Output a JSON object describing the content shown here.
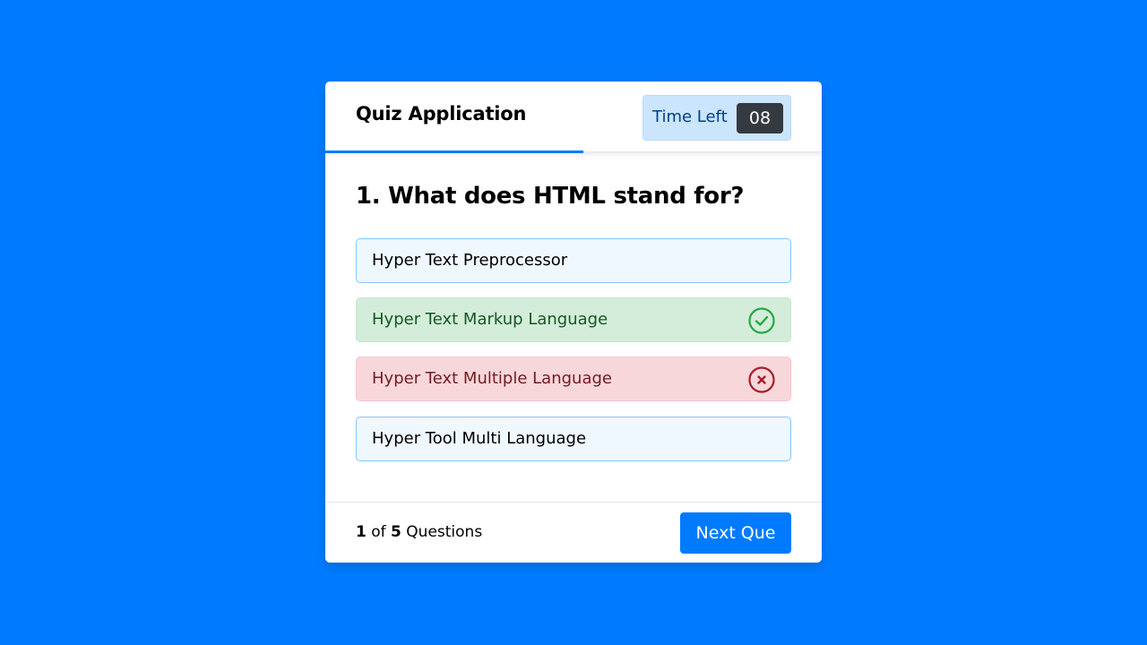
{
  "header": {
    "title": "Quiz Application",
    "timer_label": "Time Left",
    "timer_value": "08"
  },
  "question": {
    "text": "1. What does HTML stand for?"
  },
  "options": [
    {
      "label": "Hyper Text Preprocessor",
      "state": "default"
    },
    {
      "label": "Hyper Text Markup Language",
      "state": "correct",
      "icon": "check-circle-icon"
    },
    {
      "label": "Hyper Text Multiple Language",
      "state": "incorrect",
      "icon": "cross-circle-icon"
    },
    {
      "label": "Hyper Tool Multi Language",
      "state": "default"
    }
  ],
  "footer": {
    "current": "1",
    "of_text": "of",
    "total": "5",
    "questions_text": "Questions",
    "next_label": "Next Que"
  },
  "progress": 0.52,
  "colors": {
    "background": "#007bff",
    "accent": "#007bff",
    "correct": "#28a745",
    "incorrect": "#dc3545"
  }
}
